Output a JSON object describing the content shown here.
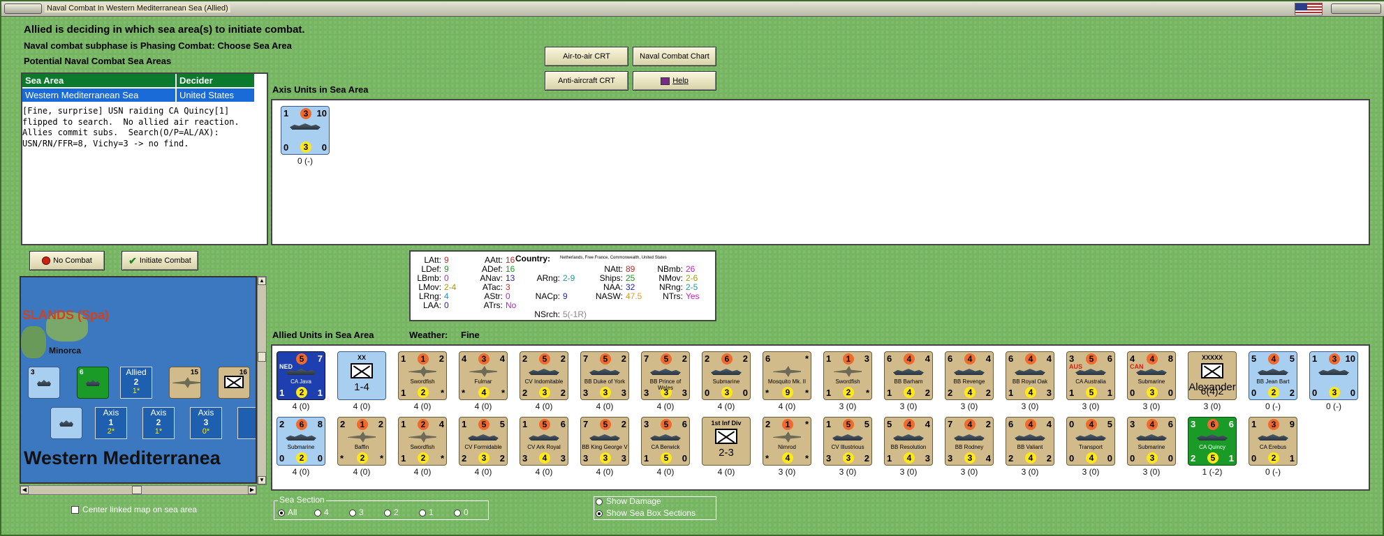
{
  "window": {
    "title": "Naval Combat In Western Mediterranean Sea (Allied)"
  },
  "header": {
    "line1": "Allied is deciding in which sea area(s) to initiate combat.",
    "line2": "Naval combat subphase is Phasing Combat: Choose Sea Area",
    "line3": "Potential Naval Combat Sea Areas"
  },
  "sea_table": {
    "headers": [
      "Sea Area",
      "Decider"
    ],
    "rows": [
      {
        "sea_area": "Western Mediterranean Sea",
        "decider": "United States"
      }
    ]
  },
  "log_text": "[Fine, surprise] USN raiding CA Quincy[1] flipped to search.  No allied air reaction.  Allies commit subs.  Search(O/P=AL/AX):  USN/RN/FFR=8, Vichy=3 -> no find.",
  "buttons": {
    "air_to_air": "Air-to-air CRT",
    "naval_chart": "Naval Combat Chart",
    "anti_aircraft": "Anti-aircraft CRT",
    "help": "Help",
    "no_combat": "No Combat",
    "initiate_combat": "Initiate Combat"
  },
  "axis_panel": {
    "label": "Axis Units in Sea Area",
    "units": [
      {
        "tl": "1",
        "top": "3",
        "tr": "10",
        "bl": "0",
        "bot": "3",
        "br": "0",
        "caption": "0 (-)"
      }
    ]
  },
  "stats": {
    "country_label": "Country:",
    "country_value": "Netherlands, Free France, Commonwealth, United States",
    "col1": [
      {
        "k": "LAtt:",
        "v": "9",
        "c": "#d42020"
      },
      {
        "k": "LDef:",
        "v": "9",
        "c": "#1a9a1a"
      },
      {
        "k": "LBmb:",
        "v": "0",
        "c": "#c020c0"
      },
      {
        "k": "LMov:",
        "v": "2-4",
        "c": "#a0a000"
      },
      {
        "k": "LRng:",
        "v": "4",
        "c": "#2b8ad8"
      },
      {
        "k": "LAA:",
        "v": "0",
        "c": "#2020c0"
      }
    ],
    "col2": [
      {
        "k": "AAtt:",
        "v": "16",
        "c": "#d42020"
      },
      {
        "k": "ADef:",
        "v": "16",
        "c": "#1a9a1a"
      },
      {
        "k": "ANav:",
        "v": "13",
        "c": "#2020c0"
      },
      {
        "k": "ATac:",
        "v": "3",
        "c": "#d42020"
      },
      {
        "k": "AStr:",
        "v": "0",
        "c": "#c020c0"
      },
      {
        "k": "ATrs:",
        "v": "No",
        "c": "#c020c0"
      }
    ],
    "col3": [
      {
        "k": "ARng:",
        "v": "2-9",
        "c": "#1a9a9a"
      },
      {
        "k": "NACp:",
        "v": "9",
        "c": "#2020c0"
      },
      {
        "k": "NSrch:",
        "v": "5(-1R)",
        "c": "#888888"
      }
    ],
    "col4": [
      {
        "k": "NAtt:",
        "v": "89",
        "c": "#d42020"
      },
      {
        "k": "Ships:",
        "v": "25",
        "c": "#1a9a1a"
      },
      {
        "k": "NAA:",
        "v": "32",
        "c": "#2020c0"
      },
      {
        "k": "NASW:",
        "v": "47.5",
        "c": "#e09a20"
      }
    ],
    "col5": [
      {
        "k": "NBmb:",
        "v": "26",
        "c": "#c020c0"
      },
      {
        "k": "NMov:",
        "v": "2-6",
        "c": "#a0a000"
      },
      {
        "k": "NRng:",
        "v": "2-5",
        "c": "#1a9a9a"
      },
      {
        "k": "NTrs:",
        "v": "Yes",
        "c": "#c020c0"
      }
    ]
  },
  "allied_panel": {
    "label": "Allied Units in Sea Area",
    "weather_label": "Weather:",
    "weather_value": "Fine",
    "row1": [
      {
        "type": "navy",
        "tl": "",
        "top": "5",
        "tr": "7",
        "bl": "1",
        "bot": "2",
        "br": "1",
        "name": "CA Java",
        "caption": "4 (0)",
        "tag": "NED"
      },
      {
        "type": "army-blue",
        "tl": "",
        "top": "",
        "tr": "",
        "bl": "",
        "bot": "",
        "br": "",
        "name": "1-4",
        "caption": "4 (0)",
        "tag": "XX"
      },
      {
        "type": "plane",
        "tl": "1",
        "top": "1",
        "tr": "2",
        "bl": "1",
        "bot": "2",
        "br": "*",
        "name": "Swordfish",
        "caption": "4 (0)"
      },
      {
        "type": "plane",
        "tl": "4",
        "top": "3",
        "tr": "4",
        "bl": "*",
        "bot": "4",
        "br": "*",
        "name": "Fulmar",
        "caption": "4 (0)"
      },
      {
        "type": "ship",
        "tl": "2",
        "top": "5",
        "tr": "2",
        "bl": "2",
        "bot": "3",
        "br": "2",
        "name": "CV Indomitable",
        "caption": "4 (0)"
      },
      {
        "type": "ship",
        "tl": "7",
        "top": "5",
        "tr": "2",
        "bl": "3",
        "bot": "3",
        "br": "3",
        "name": "BB Duke of York",
        "caption": "4 (0)"
      },
      {
        "type": "ship",
        "tl": "7",
        "top": "5",
        "tr": "2",
        "bl": "3",
        "bot": "3",
        "br": "3",
        "name": "BB Prince of Wales",
        "caption": "4 (0)"
      },
      {
        "type": "ship",
        "tl": "2",
        "top": "6",
        "tr": "2",
        "bl": "0",
        "bot": "3",
        "br": "0",
        "name": "Submarine",
        "caption": "4 (0)"
      },
      {
        "type": "plane",
        "tl": "6",
        "top": "",
        "tr": "*",
        "bl": "*",
        "bot": "9",
        "br": "*",
        "name": "Mosquito Mk. II",
        "caption": "4 (0)"
      },
      {
        "type": "plane",
        "tl": "1",
        "top": "1",
        "tr": "3",
        "bl": "1",
        "bot": "2",
        "br": "*",
        "name": "Swordfish",
        "caption": "3 (0)"
      },
      {
        "type": "ship",
        "tl": "6",
        "top": "4",
        "tr": "4",
        "bl": "1",
        "bot": "4",
        "br": "2",
        "name": "BB Barham",
        "caption": "3 (0)"
      },
      {
        "type": "ship",
        "tl": "6",
        "top": "4",
        "tr": "4",
        "bl": "2",
        "bot": "4",
        "br": "2",
        "name": "BB Revenge",
        "caption": "3 (0)"
      },
      {
        "type": "ship",
        "tl": "6",
        "top": "4",
        "tr": "4",
        "bl": "1",
        "bot": "4",
        "br": "3",
        "name": "BB Royal Oak",
        "caption": "3 (0)"
      },
      {
        "type": "ship",
        "tl": "3",
        "top": "5",
        "tr": "6",
        "bl": "1",
        "bot": "5",
        "br": "1",
        "name": "CA Australia",
        "caption": "3 (0)",
        "tag": "AUS"
      },
      {
        "type": "ship",
        "tl": "4",
        "top": "4",
        "tr": "8",
        "bl": "0",
        "bot": "3",
        "br": "0",
        "name": "Submarine",
        "caption": "3 (0)",
        "tag": "CAN"
      },
      {
        "type": "army",
        "tl": "",
        "top": "",
        "tr": "",
        "bl": "6(4)2",
        "bot": "",
        "br": "",
        "name": "Alexander",
        "caption": "3 (0)",
        "tag": "XXXXX"
      },
      {
        "type": "ship-blue",
        "tl": "5",
        "top": "4",
        "tr": "5",
        "bl": "0",
        "bot": "2",
        "br": "2",
        "name": "BB Jean Bart",
        "caption": "0 (-)"
      },
      {
        "type": "ship-blue",
        "tl": "1",
        "top": "3",
        "tr": "10",
        "bl": "0",
        "bot": "3",
        "br": "0",
        "name": "",
        "caption": "0 (-)"
      }
    ],
    "row2": [
      {
        "type": "ship-blue",
        "tl": "2",
        "top": "6",
        "tr": "8",
        "bl": "0",
        "bot": "2",
        "br": "0",
        "name": "Submarine",
        "caption": "4 (0)"
      },
      {
        "type": "plane",
        "tl": "2",
        "top": "1",
        "tr": "2",
        "bl": "*",
        "bot": "2",
        "br": "*",
        "name": "Baffin",
        "caption": "4 (0)"
      },
      {
        "type": "plane",
        "tl": "1",
        "top": "2",
        "tr": "4",
        "bl": "1",
        "bot": "2",
        "br": "*",
        "name": "Swordfish",
        "caption": "4 (0)"
      },
      {
        "type": "ship",
        "tl": "1",
        "top": "5",
        "tr": "5",
        "bl": "2",
        "bot": "3",
        "br": "2",
        "name": "CV Formidable",
        "caption": "4 (0)"
      },
      {
        "type": "ship",
        "tl": "1",
        "top": "5",
        "tr": "6",
        "bl": "3",
        "bot": "4",
        "br": "3",
        "name": "CV Ark Royal",
        "caption": "4 (0)"
      },
      {
        "type": "ship",
        "tl": "7",
        "top": "5",
        "tr": "2",
        "bl": "3",
        "bot": "3",
        "br": "3",
        "name": "BB King George V",
        "caption": "4 (0)"
      },
      {
        "type": "ship",
        "tl": "3",
        "top": "5",
        "tr": "6",
        "bl": "1",
        "bot": "5",
        "br": "0",
        "name": "CA Berwick",
        "caption": "4 (0)"
      },
      {
        "type": "army",
        "tl": "",
        "top": "",
        "tr": "",
        "bl": "",
        "bot": "",
        "br": "",
        "name": "2-3",
        "caption": "4 (0)",
        "tag": "1st Inf Div"
      },
      {
        "type": "plane",
        "tl": "2",
        "top": "1",
        "tr": "*",
        "bl": "*",
        "bot": "4",
        "br": "*",
        "name": "Nimrod",
        "caption": "3 (0)"
      },
      {
        "type": "ship",
        "tl": "1",
        "top": "5",
        "tr": "5",
        "bl": "3",
        "bot": "3",
        "br": "2",
        "name": "CV Illustrious",
        "caption": "3 (0)"
      },
      {
        "type": "ship",
        "tl": "5",
        "top": "4",
        "tr": "4",
        "bl": "1",
        "bot": "4",
        "br": "3",
        "name": "BB Resolution",
        "caption": "3 (0)"
      },
      {
        "type": "ship",
        "tl": "7",
        "top": "4",
        "tr": "2",
        "bl": "3",
        "bot": "3",
        "br": "4",
        "name": "BB Rodney",
        "caption": "3 (0)"
      },
      {
        "type": "ship",
        "tl": "6",
        "top": "4",
        "tr": "4",
        "bl": "2",
        "bot": "4",
        "br": "2",
        "name": "BB Valiant",
        "caption": "3 (0)"
      },
      {
        "type": "ship",
        "tl": "0",
        "top": "4",
        "tr": "5",
        "bl": "0",
        "bot": "4",
        "br": "0",
        "name": "Transport",
        "caption": "3 (0)"
      },
      {
        "type": "ship",
        "tl": "3",
        "top": "4",
        "tr": "6",
        "bl": "0",
        "bot": "3",
        "br": "0",
        "name": "Submarine",
        "caption": "3 (0)"
      },
      {
        "type": "green",
        "tl": "3",
        "top": "6",
        "tr": "6",
        "bl": "2",
        "bot": "5",
        "br": "1",
        "name": "CA Quincy",
        "caption": "1 (-2)"
      },
      {
        "type": "ship",
        "tl": "1",
        "top": "3",
        "tr": "9",
        "bl": "0",
        "bot": "2",
        "br": "1",
        "name": "CA Erebus",
        "caption": "0 (-)"
      }
    ]
  },
  "map": {
    "region": "SLANDS (Spa)",
    "island": "Minorca",
    "title": "Western Mediterranea",
    "boxes": [
      {
        "label": "Allied",
        "num": "2",
        "val": "1*"
      },
      {
        "label": "Axis",
        "num": "1",
        "val": "2*"
      },
      {
        "label": "Axis",
        "num": "2",
        "val": "1*"
      },
      {
        "label": "Axis",
        "num": "3",
        "val": "0*"
      }
    ],
    "stack_numbers": [
      "3",
      "6",
      "15",
      "16"
    ]
  },
  "controls": {
    "center_map_label": "Center linked map on sea area",
    "sea_section_title": "Sea Section",
    "sea_section_options": [
      "All",
      "4",
      "3",
      "2",
      "1",
      "0"
    ],
    "show_damage": "Show Damage",
    "show_sea_box": "Show Sea Box Sections"
  }
}
